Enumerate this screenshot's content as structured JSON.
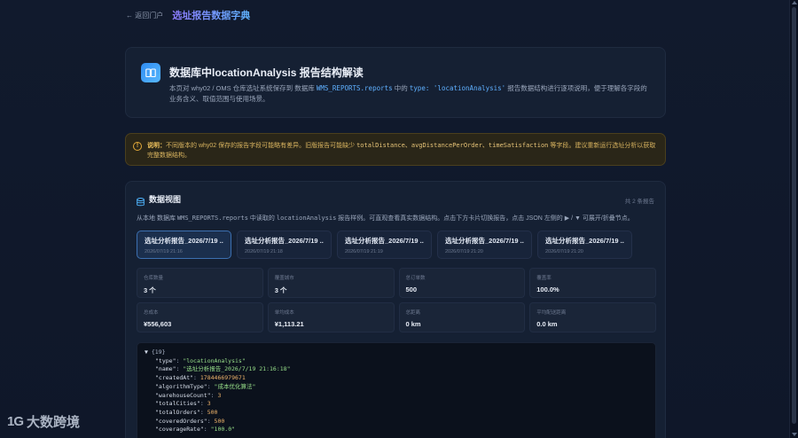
{
  "header": {
    "back_label": "← 返回门户",
    "title": "选址报告数据字典"
  },
  "intro": {
    "icon": "book-icon",
    "title": "数据库中locationAnalysis 报告结构解读",
    "desc_prefix": "本页对 why02 / OMS 仓库选址系统保存到 数据库",
    "desc_code1": "WMS_REPORTS.reports",
    "desc_mid": " 中的 ",
    "desc_code2": "type: 'locationAnalysis'",
    "desc_suffix": " 报告数据结构进行逐项说明，便于理解各字段的业务含义、取值范围与使用场景。"
  },
  "notice": {
    "icon": "info-circle-icon",
    "label": "说明：",
    "text_a": "不同版本的 why02 保存的报告字段可能略有差异。旧版报告可能缺少 ",
    "code": "totalDistance、avgDistancePerOrder、timeSatisfaction",
    "text_b": " 等字段。建议重新运行选址分析以获取完整数据结构。"
  },
  "dataview": {
    "title": "数据视图",
    "count": "共 2 条报告",
    "desc_a": "从本地 数据库 ",
    "desc_code1": "WMS_REPORTS.reports",
    "desc_b": " 中读取的 ",
    "desc_code2": "locationAnalysis",
    "desc_c": " 报告样例。可直观查看真实数据结构。点击下方卡片切换报告，点击 JSON 左侧的 ▶ / ▼ 可展开/折叠节点。",
    "tabs": [
      {
        "name": "选址分析报告_2026/7/19 ...",
        "time": "2026/07/19 21:16"
      },
      {
        "name": "选址分析报告_2026/7/19 ...",
        "time": "2026/07/19 21:18"
      },
      {
        "name": "选址分析报告_2026/7/19 ...",
        "time": "2026/07/19 21:19"
      },
      {
        "name": "选址分析报告_2026/7/19 ...",
        "time": "2026/07/19 21:20"
      },
      {
        "name": "选址分析报告_2026/7/19 ...",
        "time": "2026/07/19 21:20"
      }
    ],
    "stats": [
      {
        "label": "仓库数量",
        "value": "3 个"
      },
      {
        "label": "覆盖城市",
        "value": "3 个"
      },
      {
        "label": "总订单数",
        "value": "500"
      },
      {
        "label": "覆盖率",
        "value": "100.0%"
      },
      {
        "label": "总成本",
        "value": "¥556,603"
      },
      {
        "label": "单均成本",
        "value": "¥1,113.21"
      },
      {
        "label": "总距离",
        "value": "0 km"
      },
      {
        "label": "平均配送距离",
        "value": "0.0 km"
      }
    ],
    "json": {
      "toggle": "▼",
      "count": "{19}",
      "lines": [
        {
          "k": "\"type\"",
          "v": "\"locationAnalysis\"",
          "t": "s"
        },
        {
          "k": "\"name\"",
          "v": "\"选址分析报告_2026/7/19 21:16:18\"",
          "t": "s"
        },
        {
          "k": "\"createdAt\"",
          "v": "1784466979671",
          "t": "n"
        },
        {
          "k": "\"algorithmType\"",
          "v": "\"成本优化算法\"",
          "t": "s"
        },
        {
          "k": "\"warehouseCount\"",
          "v": "3",
          "t": "n"
        },
        {
          "k": "\"totalCities\"",
          "v": "3",
          "t": "n"
        },
        {
          "k": "\"totalOrders\"",
          "v": "500",
          "t": "n"
        },
        {
          "k": "\"coveredOrders\"",
          "v": "500",
          "t": "n"
        },
        {
          "k": "\"coverageRate\"",
          "v": "\"100.0\"",
          "t": "s"
        }
      ]
    }
  },
  "watermark": {
    "logo": "1G",
    "text": "大数跨境"
  }
}
